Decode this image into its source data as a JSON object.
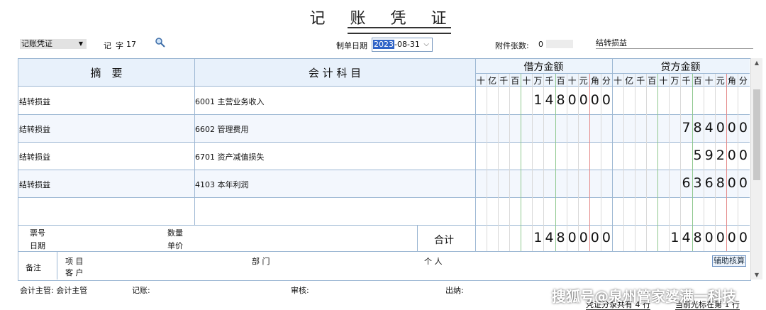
{
  "title": "记 账 凭 证",
  "header": {
    "voucher_type": "记账凭证",
    "voucher_word": "记",
    "voucher_no_label": "字",
    "voucher_no": "17",
    "date_label": "制单日期",
    "date_year_sel": "2023",
    "date_rest": "-08-31",
    "attachments_label": "附件张数:",
    "attachments": "0",
    "summary": "结转损益"
  },
  "table": {
    "col_summary": "摘　要",
    "col_account": "会 计 科 目",
    "col_debit": "借方金额",
    "col_credit": "贷方金额",
    "units": [
      "十",
      "亿",
      "千",
      "百",
      "十",
      "万",
      "千",
      "百",
      "十",
      "元",
      "角",
      "分"
    ],
    "rows": [
      {
        "summary": "结转损益",
        "account": "6001 主营业务收入",
        "debit": "1480000",
        "credit": ""
      },
      {
        "summary": "结转损益",
        "account": "6602 管理费用",
        "debit": "",
        "credit": "784000"
      },
      {
        "summary": "结转损益",
        "account": "6701 资产减值损失",
        "debit": "",
        "credit": "59200"
      },
      {
        "summary": "结转损益",
        "account": "4103 本年利润",
        "debit": "",
        "credit": "636800"
      }
    ],
    "bill_no_label": "票号",
    "date_label": "日期",
    "qty_label": "数量",
    "price_label": "单价",
    "total_label": "合计",
    "total_debit": "1480000",
    "total_credit": "1480000"
  },
  "remark": {
    "label": "备注",
    "project_label": "项 目",
    "dept_label": "部 门",
    "person_label": "个 人",
    "customer_label": "客 户",
    "aux_button": "辅助核算"
  },
  "footer": {
    "supervisor": "会计主管: 会计主管",
    "bookkeeper": "记账:",
    "auditor": "审核:",
    "cashier": "出纳:",
    "entries": "凭证分录共有 4 行",
    "cursor": "当前光标在第 1 行"
  },
  "watermark": "搜狐号@泉州管家婆满一科技"
}
